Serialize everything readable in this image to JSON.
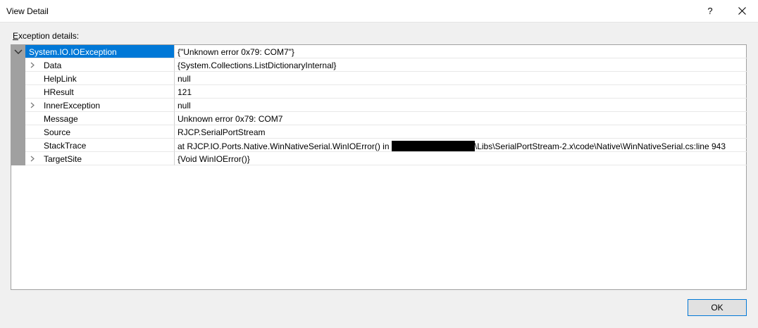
{
  "window": {
    "title": "View Detail",
    "help_label": "?"
  },
  "section": {
    "label_prefix": "",
    "label_accel": "E",
    "label_rest": "xception details:"
  },
  "rows": [
    {
      "name": "System.IO.IOException",
      "value": "{\"Unknown error 0x79: COM7\"}",
      "expandable": true,
      "expanded": true
    },
    {
      "name": "Data",
      "value": "{System.Collections.ListDictionaryInternal}",
      "expandable": true
    },
    {
      "name": "HelpLink",
      "value": "null",
      "expandable": false
    },
    {
      "name": "HResult",
      "value": "121",
      "expandable": false
    },
    {
      "name": "InnerException",
      "value": "null",
      "expandable": true
    },
    {
      "name": "Message",
      "value": "Unknown error 0x79: COM7",
      "expandable": false
    },
    {
      "name": "Source",
      "value": "RJCP.SerialPortStream",
      "expandable": false
    },
    {
      "name": "StackTrace",
      "value_before_redaction": "   at RJCP.IO.Ports.Native.WinNativeSerial.WinIOError() in ",
      "value_after_redaction": "\\Libs\\SerialPortStream-2.x\\code\\Native\\WinNativeSerial.cs:line 943",
      "expandable": false
    },
    {
      "name": "TargetSite",
      "value": "{Void WinIOError()}",
      "expandable": true
    }
  ],
  "buttons": {
    "ok_label": "OK"
  }
}
